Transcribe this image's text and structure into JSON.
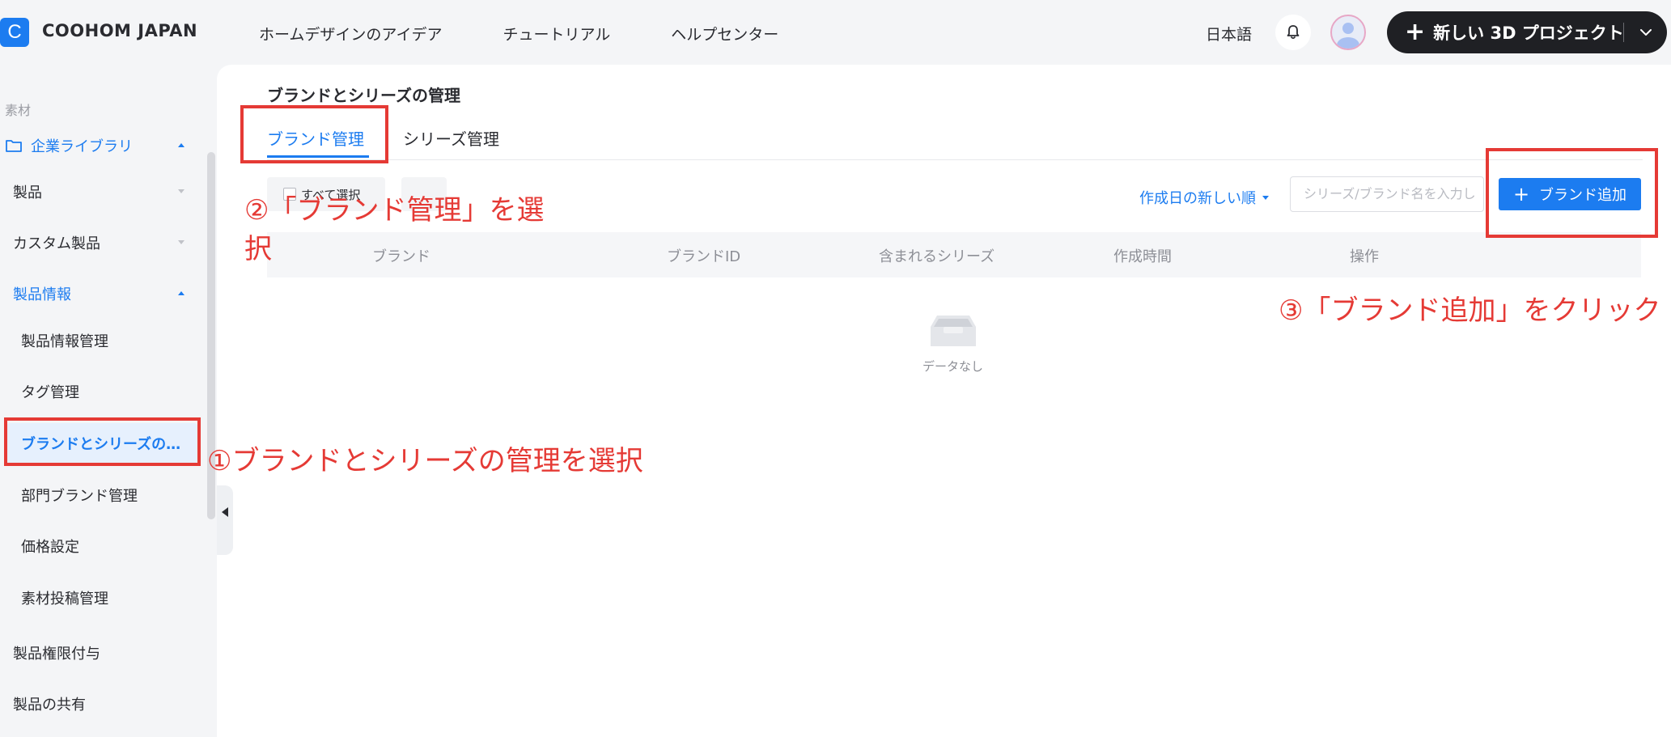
{
  "header": {
    "logo_letter": "C",
    "company": "COOHOM JAPAN",
    "nav": [
      "ホームデザインのアイデア",
      "チュートリアル",
      "ヘルプセンター"
    ],
    "language": "日本語",
    "new_project_label": "新しい 3D プロジェクト"
  },
  "sidebar": {
    "section": "素材",
    "library": "企業ライブラリ",
    "items": {
      "products": "製品",
      "custom_products": "カスタム製品",
      "product_info": "製品情報",
      "product_info_mgmt": "製品情報管理",
      "tag_mgmt": "タグ管理",
      "brand_series": "ブランドとシリーズの…",
      "dept_brand": "部門ブランド管理",
      "price": "価格設定",
      "material_post": "素材投稿管理",
      "permission": "製品権限付与",
      "share": "製品の共有"
    }
  },
  "main": {
    "title": "ブランドとシリーズの管理",
    "tabs": [
      "ブランド管理",
      "シリーズ管理"
    ],
    "select_all": "すべて選択",
    "sort_label": "作成日の新しい順",
    "search_placeholder": "シリーズ/ブランド名を入力し",
    "add_button": "ブランド追加",
    "table_headers": [
      "ブランド",
      "ブランドID",
      "含まれるシリーズ",
      "作成時間",
      "操作"
    ],
    "empty_text": "データなし"
  },
  "annotations": {
    "step1": "①ブランドとシリーズの管理を選択",
    "step2_line1": "②「ブランド管理」を選",
    "step2_line2": "択",
    "step3": "③「ブランド追加」をクリック",
    "color": "#e53a35"
  },
  "colors": {
    "accent": "#1c7cf0",
    "dark_button": "#1f2024"
  }
}
